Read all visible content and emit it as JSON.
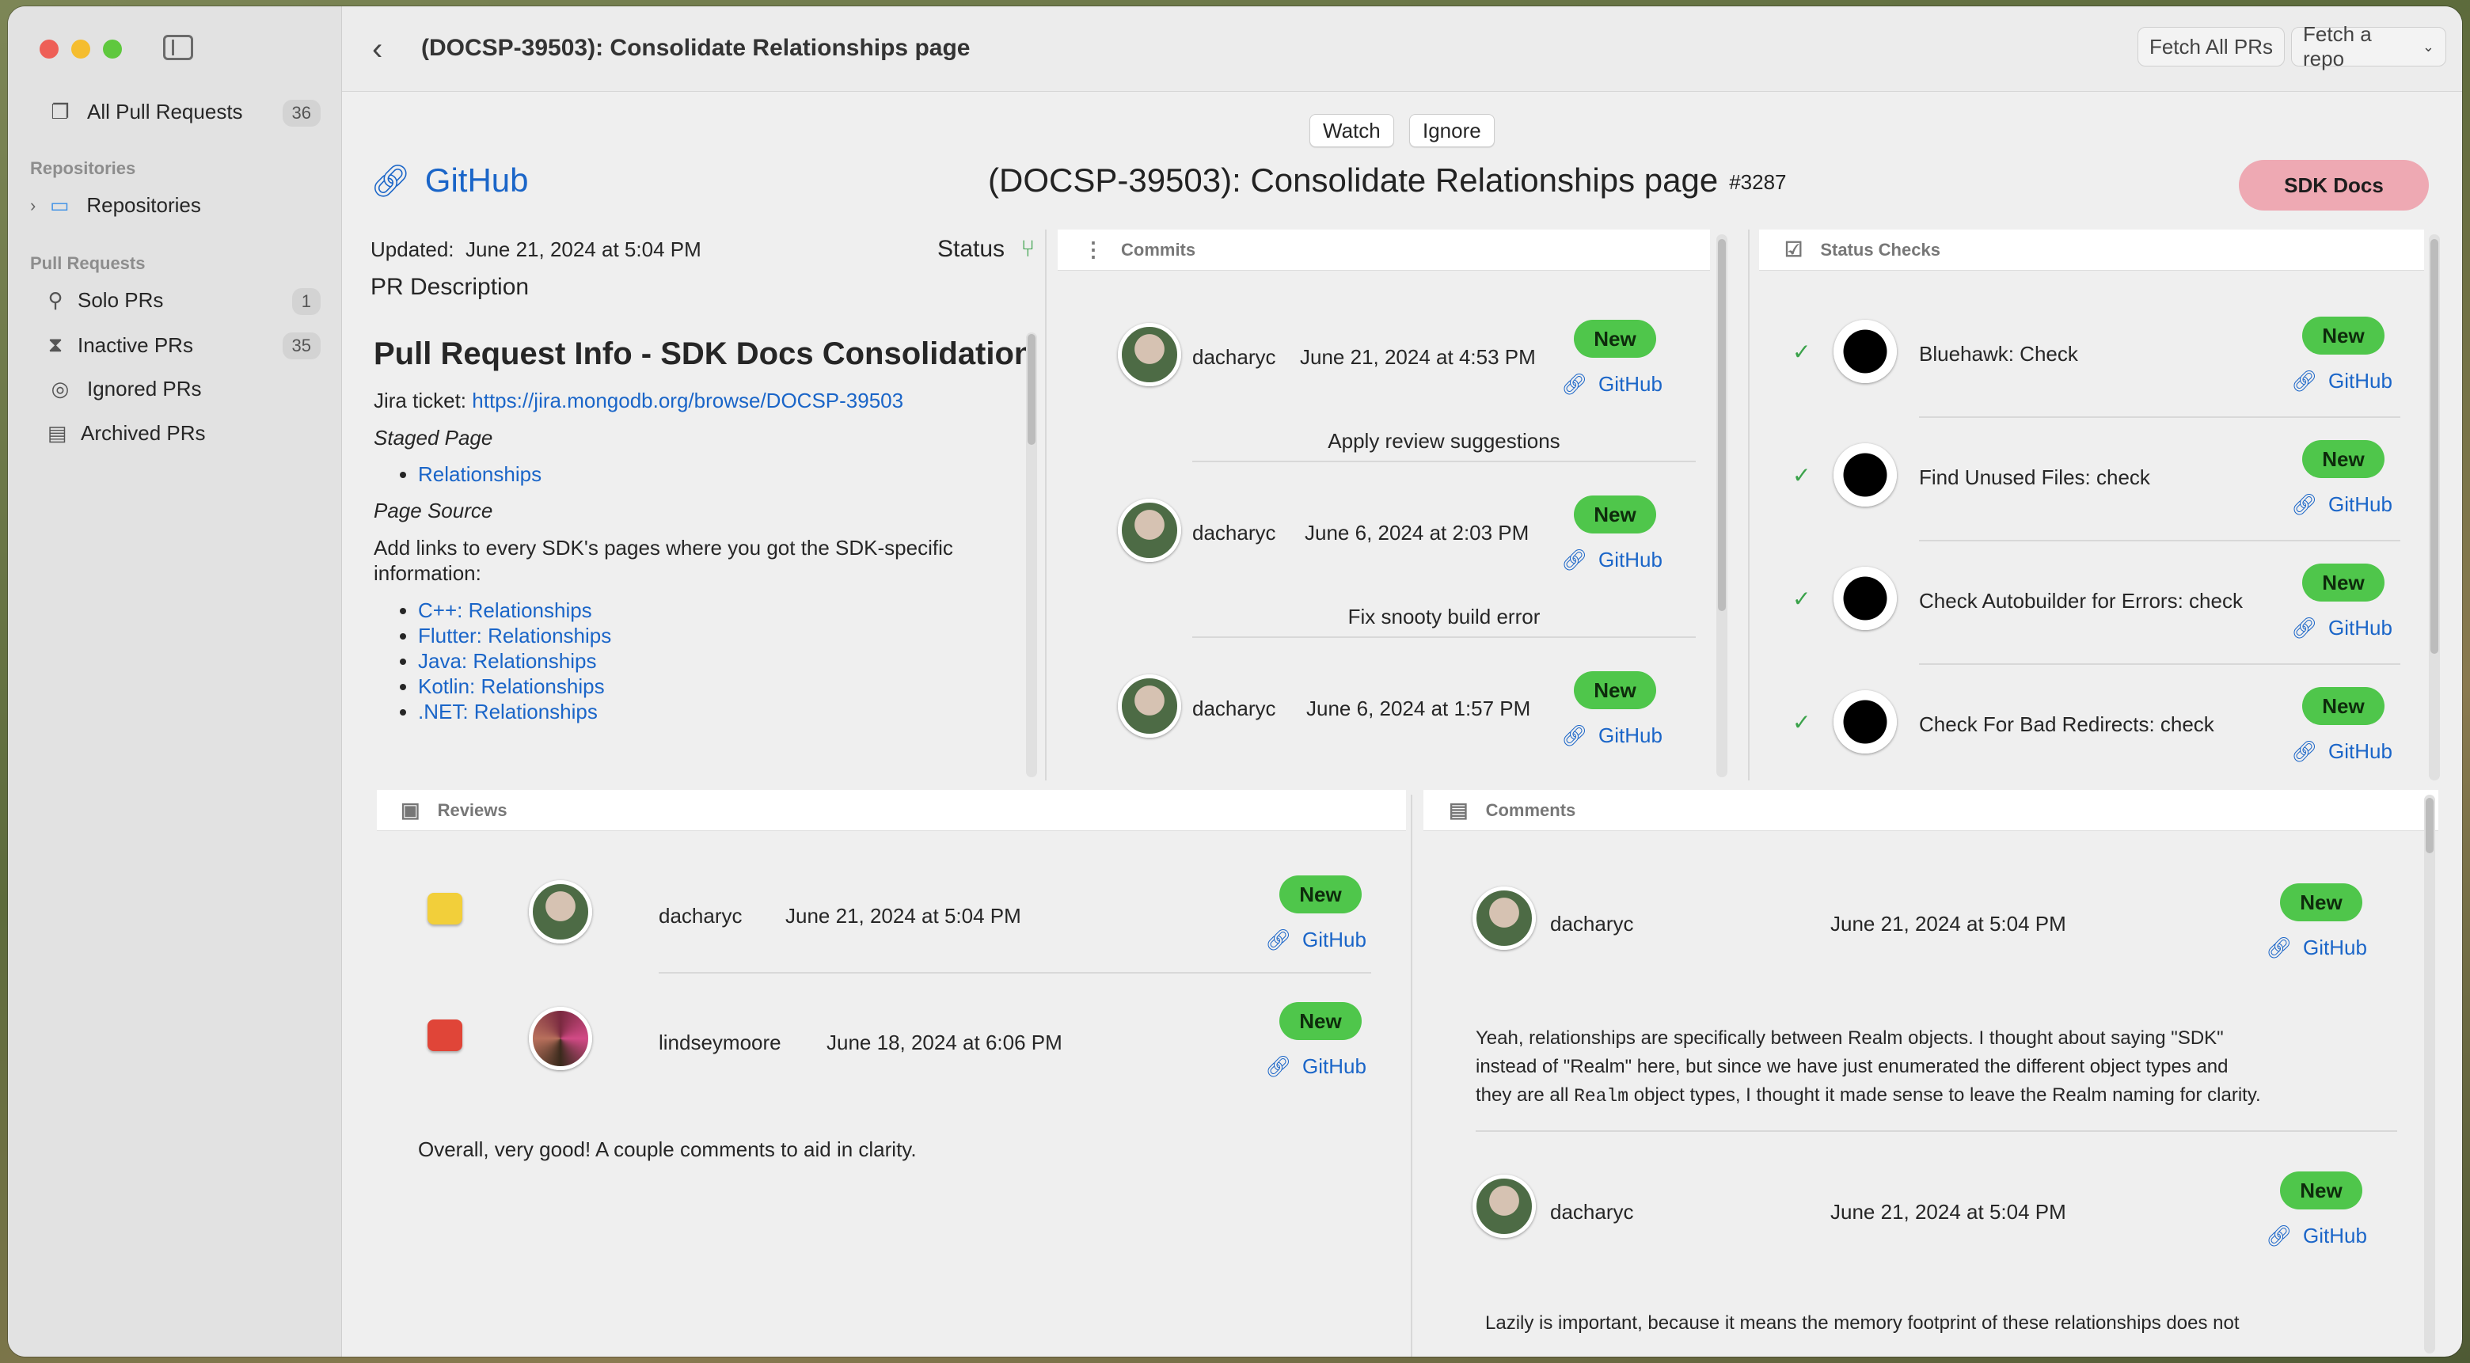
{
  "window": {
    "title": "(DOCSP-39503): Consolidate Relationships page"
  },
  "sidebar": {
    "all_prs": {
      "label": "All Pull Requests",
      "count": "36"
    },
    "repos_section": "Repositories",
    "repos_item": "Repositories",
    "prs_section": "Pull Requests",
    "items": [
      {
        "label": "Solo PRs",
        "count": "1",
        "icon": "person-icon"
      },
      {
        "label": "Inactive PRs",
        "count": "35",
        "icon": "hourglass-icon"
      },
      {
        "label": "Ignored PRs",
        "icon": "eye-slash-icon"
      },
      {
        "label": "Archived PRs",
        "icon": "archive-icon"
      }
    ]
  },
  "toolbar": {
    "fetch_all": "Fetch All PRs",
    "fetch_repo": "Fetch a repo"
  },
  "actions": {
    "watch": "Watch",
    "ignore": "Ignore"
  },
  "pr": {
    "github_label": "GitHub",
    "title": "(DOCSP-39503): Consolidate Relationships page",
    "number": "#3287",
    "repo": "SDK Docs",
    "updated_label": "Updated:",
    "updated": "June 21, 2024 at 5:04 PM",
    "status_label": "Status",
    "desc_label": "PR Description"
  },
  "description": {
    "heading": "Pull Request Info - SDK Docs Consolidation",
    "jira_label": "Jira ticket:",
    "jira_url": "https://jira.mongodb.org/browse/DOCSP-39503",
    "staged_label": "Staged Page",
    "staged_links": [
      "Relationships"
    ],
    "source_label": "Page Source",
    "source_text": "Add links to every SDK's pages where you got the SDK-specific information:",
    "source_links": [
      "C++: Relationships",
      "Flutter: Relationships",
      "Java: Relationships",
      "Kotlin: Relationships",
      ".NET: Relationships"
    ]
  },
  "commits": {
    "title": "Commits",
    "items": [
      {
        "user": "dacharyc",
        "date": "June 21, 2024 at 4:53 PM",
        "badge": "New",
        "link": "GitHub",
        "message": "Apply review suggestions"
      },
      {
        "user": "dacharyc",
        "date": "June 6, 2024 at 2:03 PM",
        "badge": "New",
        "link": "GitHub",
        "message": "Fix snooty build error"
      },
      {
        "user": "dacharyc",
        "date": "June 6, 2024 at 1:57 PM",
        "badge": "New",
        "link": "GitHub"
      }
    ]
  },
  "checks": {
    "title": "Status Checks",
    "items": [
      {
        "name": "Bluehawk: Check",
        "badge": "New",
        "link": "GitHub"
      },
      {
        "name": "Find Unused Files: check",
        "badge": "New",
        "link": "GitHub"
      },
      {
        "name": "Check Autobuilder for Errors: check",
        "badge": "New",
        "link": "GitHub"
      },
      {
        "name": "Check For Bad Redirects: check",
        "badge": "New",
        "link": "GitHub"
      }
    ]
  },
  "reviews": {
    "title": "Reviews",
    "items": [
      {
        "user": "dacharyc",
        "date": "June 21, 2024 at 5:04 PM",
        "badge": "New",
        "link": "GitHub",
        "state": "commented"
      },
      {
        "user": "lindseymoore",
        "date": "June 18, 2024 at 6:06 PM",
        "badge": "New",
        "link": "GitHub",
        "state": "changes-requested"
      }
    ],
    "body": "Overall, very good! A couple comments to aid in clarity."
  },
  "comments": {
    "title": "Comments",
    "items": [
      {
        "user": "dacharyc",
        "date": "June 21, 2024 at 5:04 PM",
        "badge": "New",
        "link": "GitHub",
        "text_a": "Yeah, relationships are specifically between Realm objects. I thought about saying \"SDK\"",
        "text_b": "instead of \"Realm\" here, but since we have just enumerated the different object types and",
        "text_c": "they are all ",
        "code": "Realm",
        "text_d": " object types, I thought it made sense to leave the Realm naming for clarity."
      },
      {
        "user": "dacharyc",
        "date": "June 21, 2024 at 5:04 PM",
        "badge": "New",
        "link": "GitHub",
        "text_a": "Lazily is important, because it means the memory footprint of these relationships does not"
      }
    ]
  },
  "colors": {
    "accent": "#1a65c8",
    "new_badge": "#4fc64b",
    "repo_pill": "#eea9b3"
  }
}
